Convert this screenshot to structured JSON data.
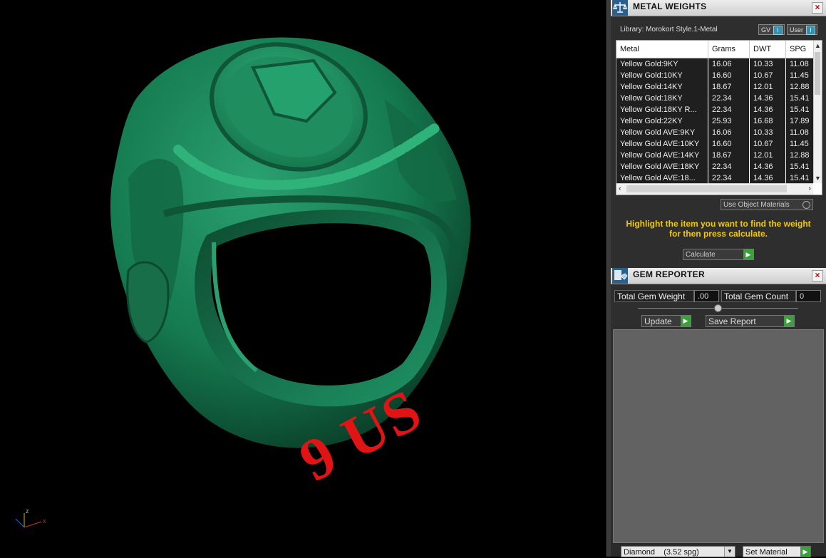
{
  "viewport": {
    "size_text": "9 US",
    "axes": {
      "x": "x",
      "z": "z"
    }
  },
  "metal_weights": {
    "title": "METAL WEIGHTS",
    "library": "Library: Morokort Style.1-Metal",
    "toggle_gv": "GV",
    "toggle_user": "User",
    "columns": [
      "Metal",
      "Grams",
      "DWT",
      "SPG"
    ],
    "rows": [
      {
        "metal": "Yellow Gold:9KY",
        "grams": "16.06",
        "dwt": "10.33",
        "spg": "11.08"
      },
      {
        "metal": "Yellow Gold:10KY",
        "grams": "16.60",
        "dwt": "10.67",
        "spg": "11.45"
      },
      {
        "metal": "Yellow Gold:14KY",
        "grams": "18.67",
        "dwt": "12.01",
        "spg": "12.88"
      },
      {
        "metal": "Yellow Gold:18KY",
        "grams": "22.34",
        "dwt": "14.36",
        "spg": "15.41"
      },
      {
        "metal": "Yellow Gold:18KY R...",
        "grams": "22.34",
        "dwt": "14.36",
        "spg": "15.41"
      },
      {
        "metal": "Yellow Gold:22KY",
        "grams": "25.93",
        "dwt": "16.68",
        "spg": "17.89"
      },
      {
        "metal": "Yellow Gold AVE:9KY",
        "grams": "16.06",
        "dwt": "10.33",
        "spg": "11.08"
      },
      {
        "metal": "Yellow Gold AVE:10KY",
        "grams": "16.60",
        "dwt": "10.67",
        "spg": "11.45"
      },
      {
        "metal": "Yellow Gold AVE:14KY",
        "grams": "18.67",
        "dwt": "12.01",
        "spg": "12.88"
      },
      {
        "metal": "Yellow Gold AVE:18KY",
        "grams": "22.34",
        "dwt": "14.36",
        "spg": "15.41"
      },
      {
        "metal": "Yellow Gold AVE:18...",
        "grams": "22.34",
        "dwt": "14.36",
        "spg": "15.41"
      }
    ],
    "use_object_materials": "Use Object Materials",
    "hint": "Highlight the item you want to find the weight for then press calculate.",
    "calculate": "Calculate"
  },
  "gem_reporter": {
    "title": "GEM REPORTER",
    "total_gem_weight_label": "Total Gem Weight",
    "total_gem_weight_value": ".00",
    "total_gem_count_label": "Total Gem Count",
    "total_gem_count_value": "0",
    "update": "Update",
    "save_report": "Save Report",
    "material_select": "Diamond    (3.52 spg)",
    "set_material": "Set Material"
  },
  "colors": {
    "ring": "#1c7a52",
    "size_label": "#e01414",
    "hint": "#f2c900"
  }
}
